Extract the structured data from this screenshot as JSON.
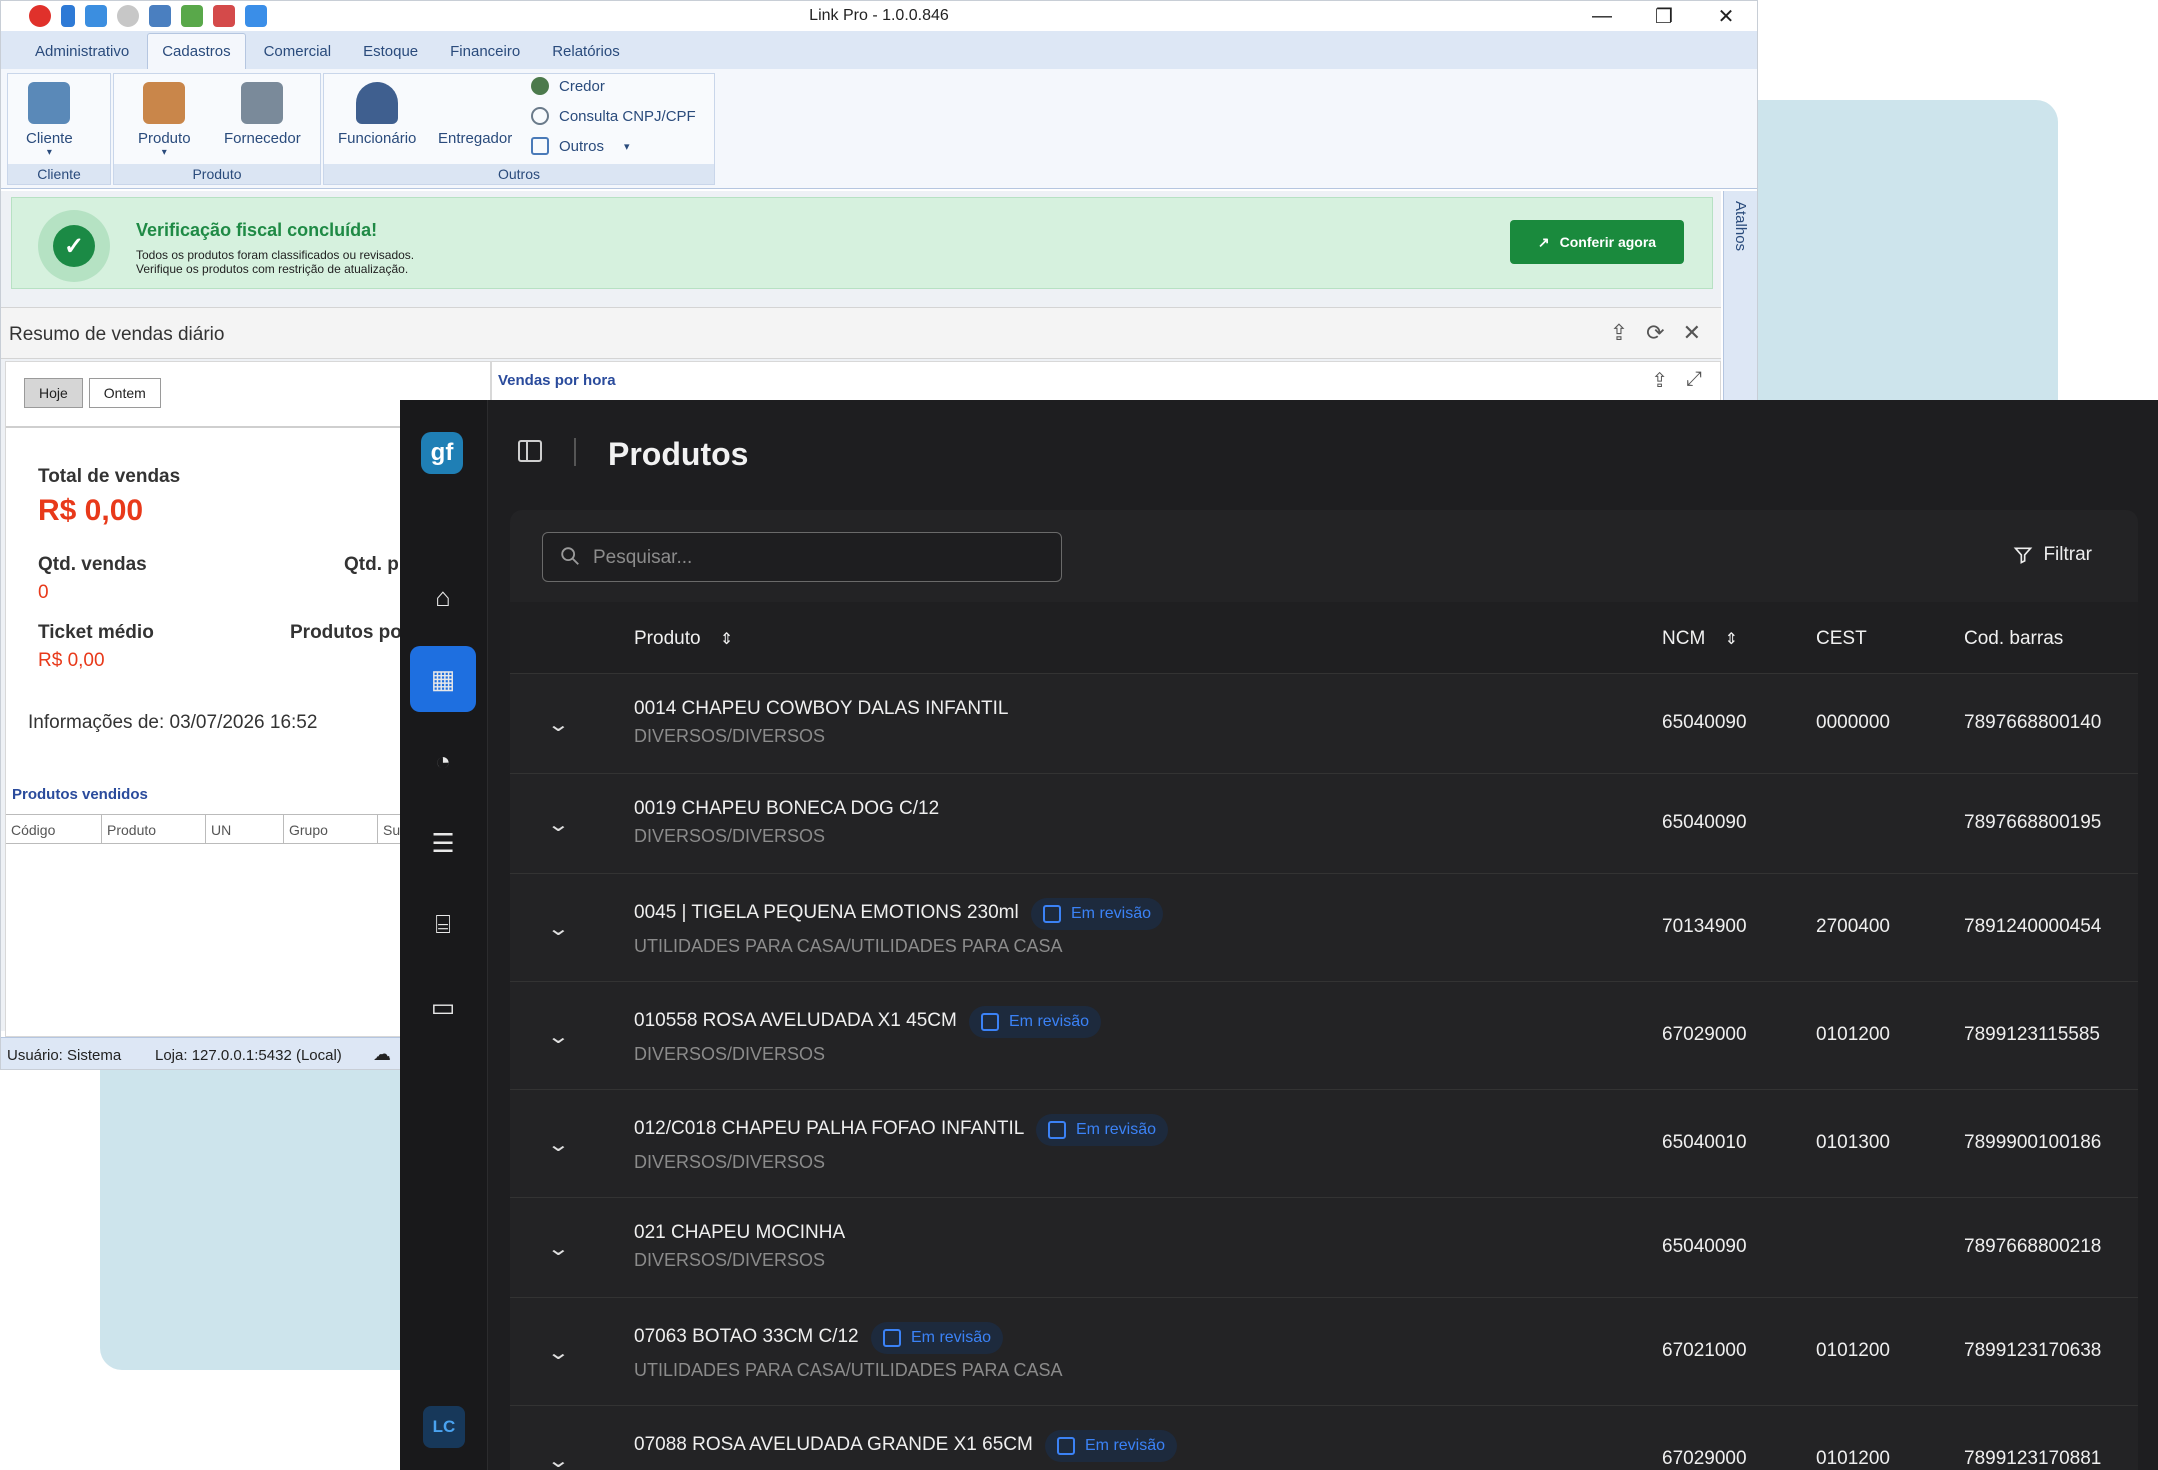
{
  "desktop": {
    "window_title": "Link Pro - 1.0.0.846",
    "controls": {
      "minimize": "—",
      "restore": "❐",
      "close": "✕"
    },
    "menu_tabs": [
      "Administrativo",
      "Cadastros",
      "Comercial",
      "Estoque",
      "Financeiro",
      "Relatórios"
    ],
    "active_tab": "Cadastros",
    "ribbon": {
      "cliente_btn": "Cliente",
      "produto_btn": "Produto",
      "fornecedor_btn": "Fornecedor",
      "funcionario_btn": "Funcionário",
      "entregador_btn": "Entregador",
      "credor": "Credor",
      "consulta": "Consulta CNPJ/CPF",
      "outros": "Outros",
      "groups": [
        "Cliente",
        "Produto",
        "Outros"
      ]
    },
    "atalhos": "Atalhos",
    "alert": {
      "title": "Verificação fiscal concluída!",
      "line1": "Todos os produtos foram classificados ou revisados.",
      "line2": "Verifique os produtos com restrição de atualização.",
      "button": "Conferir agora"
    },
    "panel": {
      "title": "Resumo de vendas diário",
      "btn_hoje": "Hoje",
      "btn_ontem": "Ontem",
      "total_label": "Total de vendas",
      "total_value": "R$ 0,00",
      "qtd_label": "Qtd. vendas",
      "qtd_value": "0",
      "qtd_p_label": "Qtd. p",
      "ticket_label": "Ticket médio",
      "ticket_value": "R$ 0,00",
      "produtos_label": "Produtos po",
      "info": "Informações de: 03/07/2026 16:52",
      "vendidos_title": "Produtos vendidos",
      "vendidos_cols": [
        "Código",
        "Produto",
        "UN",
        "Grupo",
        "Su"
      ],
      "vendas_hora": "Vendas por hora"
    },
    "status": {
      "usuario": "Usuário:  Sistema",
      "loja": "Loja:  127.0.0.1:5432 (Local)"
    }
  },
  "app": {
    "logo": "gf",
    "title": "Produtos",
    "search_placeholder": "Pesquisar...",
    "filter_label": "Filtrar",
    "avatar": "LC",
    "columns": {
      "produto": "Produto",
      "ncm": "NCM",
      "cest": "CEST",
      "barras": "Cod. barras"
    },
    "badge_label": "Em revisão",
    "rows": [
      {
        "name": "0014 CHAPEU COWBOY DALAS INFANTIL",
        "category": "DIVERSOS/DIVERSOS",
        "ncm": "65040090",
        "cest": "0000000",
        "barcode": "7897668800140",
        "in_review": false
      },
      {
        "name": "0019 CHAPEU BONECA DOG C/12",
        "category": "DIVERSOS/DIVERSOS",
        "ncm": "65040090",
        "cest": "",
        "barcode": "7897668800195",
        "in_review": false
      },
      {
        "name": "0045 | TIGELA PEQUENA EMOTIONS 230ml",
        "category": "UTILIDADES PARA CASA/UTILIDADES PARA CASA",
        "ncm": "70134900",
        "cest": "2700400",
        "barcode": "7891240000454",
        "in_review": true
      },
      {
        "name": "010558 ROSA AVELUDADA X1 45CM",
        "category": "DIVERSOS/DIVERSOS",
        "ncm": "67029000",
        "cest": "0101200",
        "barcode": "7899123115585",
        "in_review": true
      },
      {
        "name": "012/C018 CHAPEU PALHA FOFAO INFANTIL",
        "category": "DIVERSOS/DIVERSOS",
        "ncm": "65040010",
        "cest": "0101300",
        "barcode": "7899900100186",
        "in_review": true
      },
      {
        "name": "021 CHAPEU MOCINHA",
        "category": "DIVERSOS/DIVERSOS",
        "ncm": "65040090",
        "cest": "",
        "barcode": "7897668800218",
        "in_review": false
      },
      {
        "name": "07063 BOTAO 33CM C/12",
        "category": "UTILIDADES PARA CASA/UTILIDADES PARA CASA",
        "ncm": "67021000",
        "cest": "0101200",
        "barcode": "7899123170638",
        "in_review": true
      },
      {
        "name": "07088 ROSA AVELUDADA GRANDE X1 65CM",
        "category": "",
        "ncm": "67029000",
        "cest": "0101200",
        "barcode": "7899123170881",
        "in_review": true
      }
    ]
  }
}
